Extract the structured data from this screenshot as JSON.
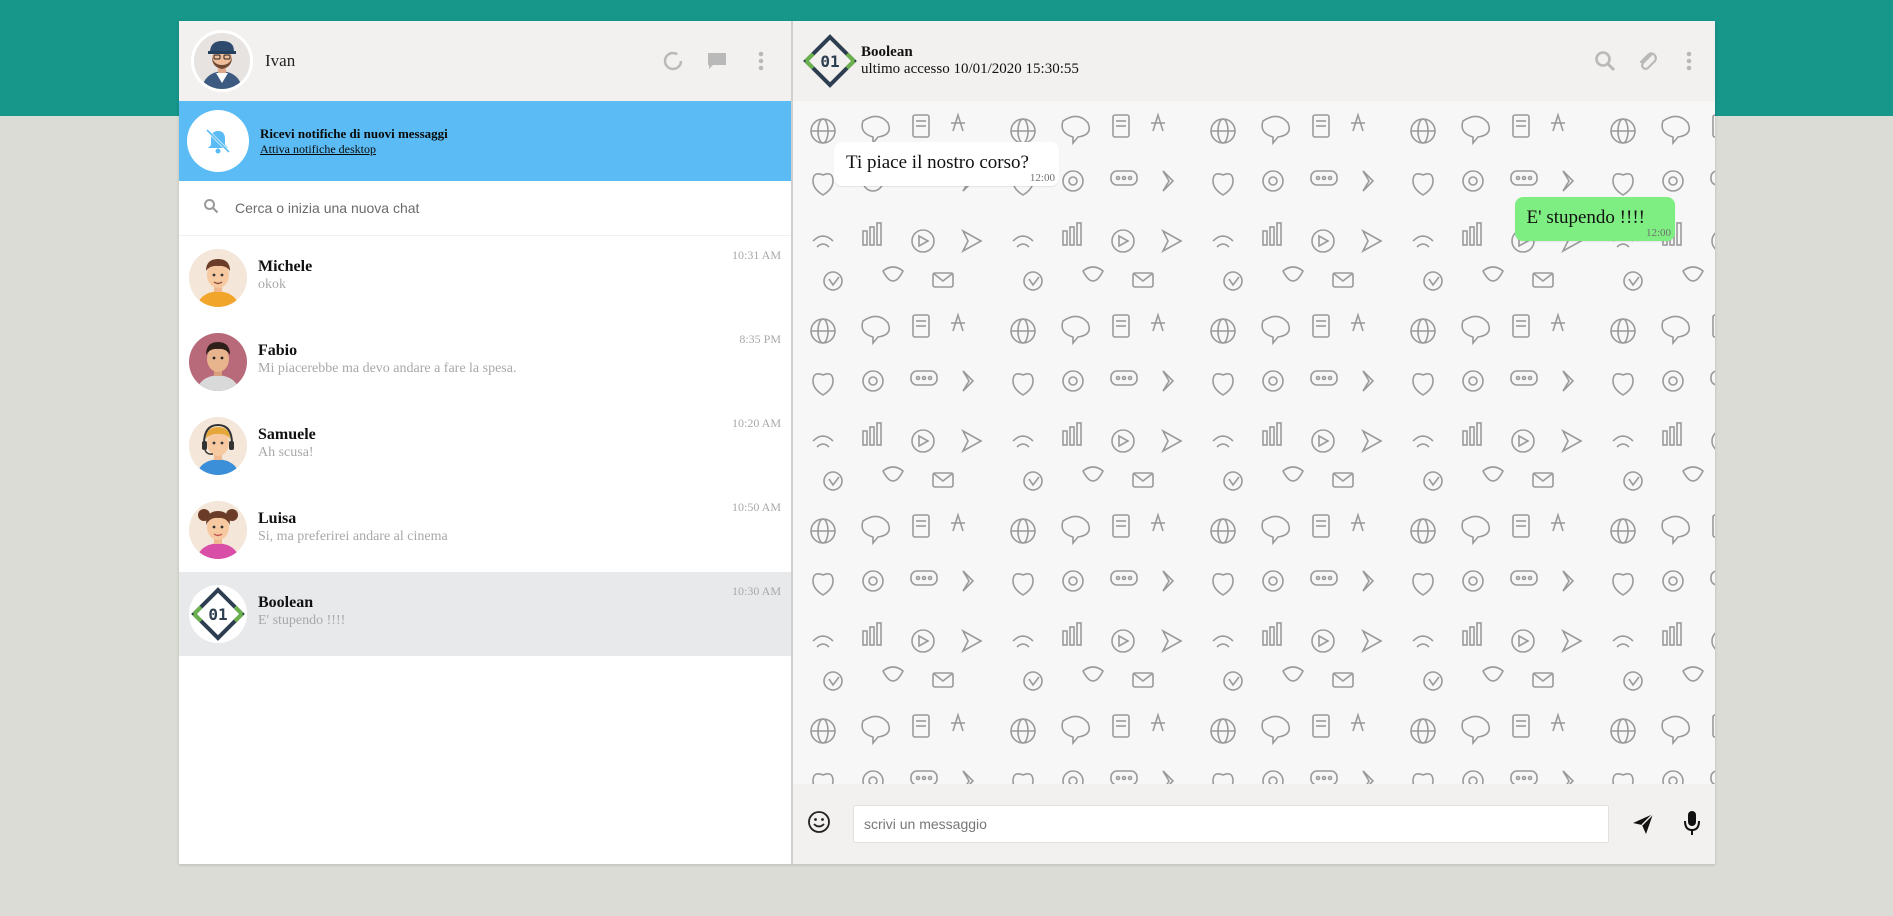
{
  "me": {
    "name": "Ivan"
  },
  "notification": {
    "title": "Ricevi notifiche di nuovi messaggi",
    "link": "Attiva notifiche desktop"
  },
  "search": {
    "placeholder": "Cerca o inizia una nuova chat"
  },
  "chats": [
    {
      "name": "Michele",
      "last": "okok",
      "time": "10:31 AM"
    },
    {
      "name": "Fabio",
      "last": "Mi piacerebbe ma devo andare a fare la spesa.",
      "time": "8:35 PM"
    },
    {
      "name": "Samuele",
      "last": "Ah scusa!",
      "time": "10:20 AM"
    },
    {
      "name": "Luisa",
      "last": "Si, ma preferirei andare al cinema",
      "time": "10:50 AM"
    },
    {
      "name": "Boolean",
      "last": "E' stupendo !!!!",
      "time": "10:30 AM"
    }
  ],
  "active_chat": {
    "name": "Boolean",
    "status": "ultimo accesso 10/01/2020 15:30:55"
  },
  "messages": [
    {
      "text": "Ti piace il nostro corso?",
      "time": "12:00",
      "type": "received"
    },
    {
      "text": "E' stupendo !!!!",
      "time": "12:00",
      "type": "sent"
    }
  ],
  "composer": {
    "placeholder": "scrivi un messaggio"
  },
  "colors": {
    "brand_band": "#17968a",
    "notification_bg": "#5bbcf5",
    "sent_bubble": "#7fee82",
    "panel_header": "#f3f1ef"
  },
  "icons": [
    "status-icon",
    "chat-icon",
    "menu-dots-icon",
    "bell-off-icon",
    "search-icon",
    "paperclip-icon",
    "emoji-icon",
    "send-icon",
    "microphone-icon"
  ]
}
